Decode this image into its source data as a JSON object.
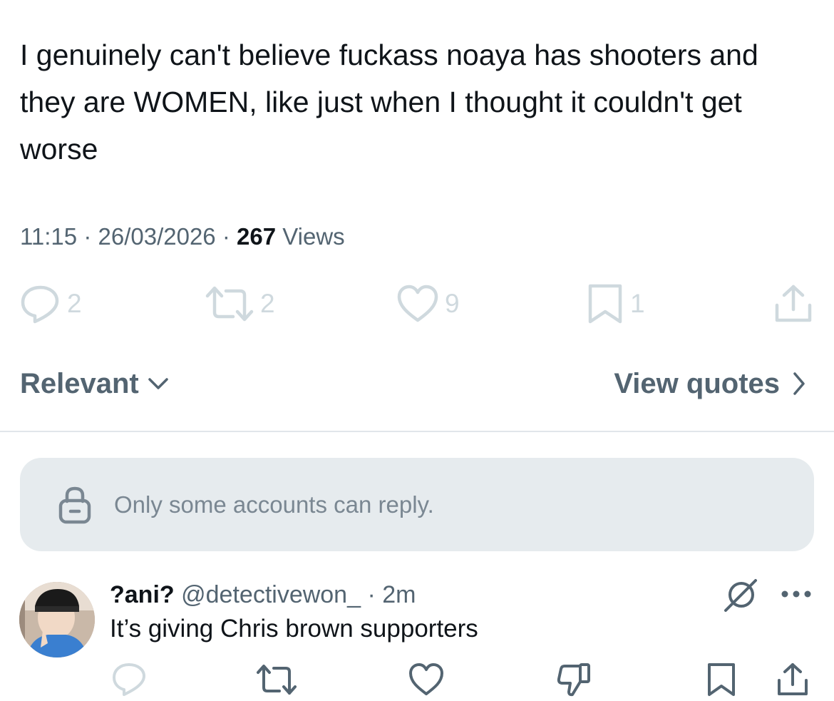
{
  "tweet": {
    "text": "I genuinely can't believe fuckass noaya has shooters and they are WOMEN, like just when I thought it couldn't get worse",
    "time": "11:15",
    "separator": "·",
    "date": "26/03/2026",
    "views_count": "267",
    "views_label": "Views"
  },
  "actions": {
    "replies": "2",
    "reposts": "2",
    "likes": "9",
    "bookmarks": "1"
  },
  "sort": {
    "relevant_label": "Relevant",
    "view_quotes_label": "View quotes"
  },
  "reply_restriction": {
    "text": "Only some accounts can reply."
  },
  "reply": {
    "name": "?ani?",
    "handle": "@detectivewon_",
    "separator": "·",
    "time": "2m",
    "text": "It’s giving Chris brown supporters"
  },
  "colors": {
    "text_primary": "#0f1419",
    "text_secondary": "#536471",
    "icon_muted": "#cfd9de",
    "banner_bg": "#e6ebee"
  }
}
